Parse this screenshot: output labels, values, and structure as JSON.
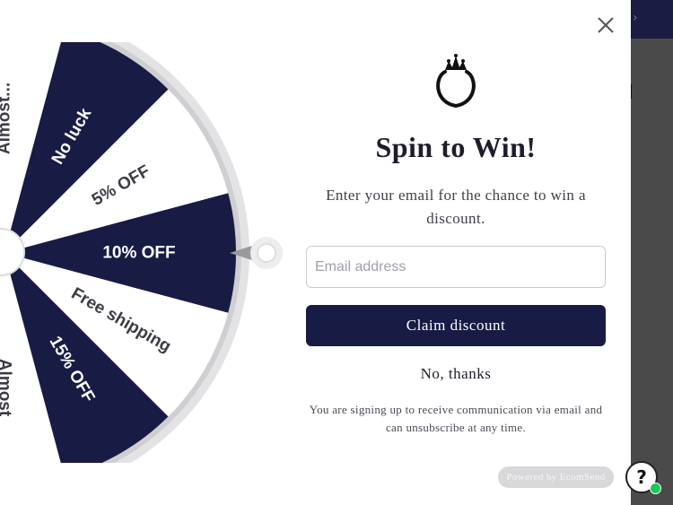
{
  "popup": {
    "title": "Spin to Win!",
    "subtitle": "Enter your email for the chance to win a discount.",
    "email": {
      "placeholder": "Email address",
      "value": ""
    },
    "claim_label": "Claim discount",
    "no_thanks_label": "No, thanks",
    "disclaimer": "You are signing up to receive communication via email and can unsubscribe at any time.",
    "powered_by": "Powered by EcomSend",
    "close_icon": "close-icon",
    "logo_icon": "crown-ring-logo-icon"
  },
  "wheel": {
    "segments": [
      {
        "label": "10% OFF",
        "color": "#181b44",
        "text_color": "#ffffff"
      },
      {
        "label": "Free shipping",
        "color": "#ffffff",
        "text_color": "#3c3c44"
      },
      {
        "label": "15% OFF",
        "color": "#181b44",
        "text_color": "#ffffff"
      },
      {
        "label": "Almost",
        "color": "#ffffff",
        "text_color": "#3c3c44"
      },
      {
        "label": "",
        "color": "#181b44",
        "text_color": "#ffffff"
      },
      {
        "label": "",
        "color": "#ffffff",
        "text_color": "#3c3c44"
      },
      {
        "label": "",
        "color": "#181b44",
        "text_color": "#ffffff"
      },
      {
        "label": "",
        "color": "#ffffff",
        "text_color": "#3c3c44"
      },
      {
        "label": "",
        "color": "#181b44",
        "text_color": "#ffffff"
      },
      {
        "label": "Almost...",
        "color": "#ffffff",
        "text_color": "#3c3c44"
      },
      {
        "label": "No luck",
        "color": "#181b44",
        "text_color": "#ffffff"
      },
      {
        "label": "5% OFF",
        "color": "#ffffff",
        "text_color": "#3c3c44"
      }
    ],
    "pointer_icon": "wheel-pointer-icon"
  },
  "help_widget": {
    "icon": "question-mark-icon",
    "label": "?"
  },
  "colors": {
    "navy": "#181b44",
    "white": "#ffffff",
    "rim": "#e2e2e4"
  }
}
